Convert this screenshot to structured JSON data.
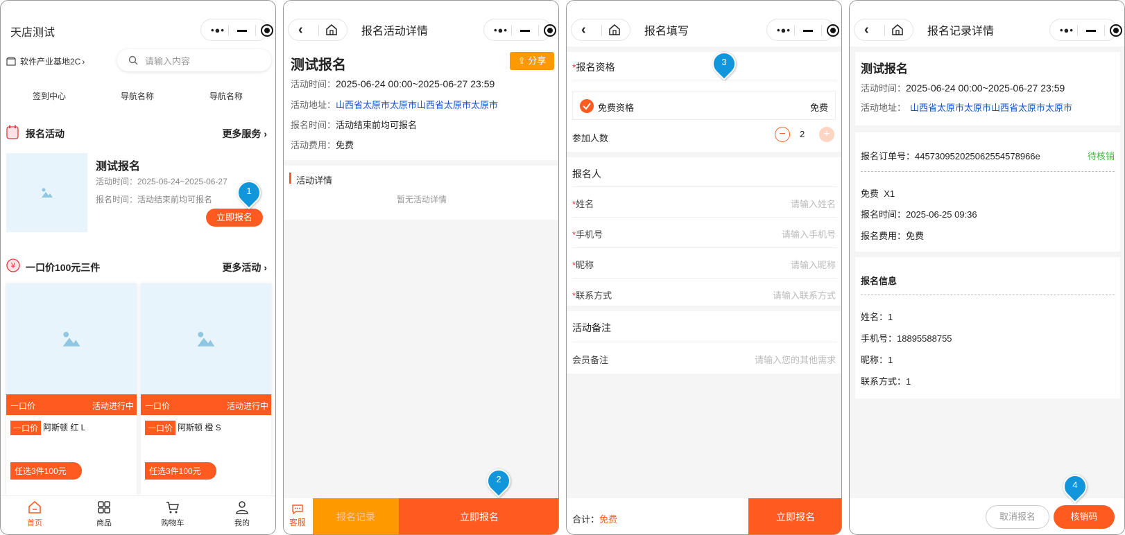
{
  "screen1": {
    "title": "天店测试",
    "location": "软件产业基地2C",
    "search_placeholder": "请输入内容",
    "nav_items": [
      "签到中心",
      "导航名称",
      "导航名称"
    ],
    "section1_title": "报名活动",
    "section1_more": "更多服务",
    "activity": {
      "name": "测试报名",
      "time": "活动时间：2025-06-24~2025-06-27",
      "signup": "报名时间：活动结束前均可报名",
      "button": "立即报名"
    },
    "section2_title": "一口价100元三件",
    "section2_more": "更多活动",
    "products": [
      {
        "ribbon_left": "一口价",
        "ribbon_right": "活动进行中",
        "tag": "一口价",
        "name": "阿斯顿 红 L",
        "promo": "任选3件100元"
      },
      {
        "ribbon_left": "一口价",
        "ribbon_right": "活动进行中",
        "tag": "一口价",
        "name": "阿斯顿 橙 S",
        "promo": "任选3件100元"
      }
    ],
    "tabs": [
      "首页",
      "商品",
      "购物车",
      "我的"
    ],
    "pin": "1"
  },
  "screen2": {
    "title": "报名活动详情",
    "name": "测试报名",
    "share": "分享",
    "time_label": "活动时间：",
    "time_value": "2025-06-24 00:00~2025-06-27 23:59",
    "address_label": "活动地址：",
    "address_value": "山西省太原市太原市山西省太原市太原市",
    "signup_label": "报名时间：",
    "signup_value": "活动结束前均可报名",
    "fee_label": "活动费用：",
    "fee_value": "免费",
    "detail_title": "活动详情",
    "detail_empty": "暂无活动详情",
    "service": "客服",
    "records_btn": "报名记录",
    "signup_btn": "立即报名",
    "pin": "2"
  },
  "screen3": {
    "title": "报名填写",
    "qual_label": "报名资格",
    "qual_option": "免费资格",
    "qual_price": "免费",
    "count_label": "参加人数",
    "count_value": "2",
    "person_title": "报名人",
    "fields": [
      {
        "label": "姓名",
        "placeholder": "请输入姓名"
      },
      {
        "label": "手机号",
        "placeholder": "请输入手机号"
      },
      {
        "label": "昵称",
        "placeholder": "请输入昵称"
      },
      {
        "label": "联系方式",
        "placeholder": "请输入联系方式"
      }
    ],
    "remark_title": "活动备注",
    "remark_label": "会员备注",
    "remark_placeholder": "请输入您的其他需求",
    "total_label": "合计：",
    "total_value": "免费",
    "submit": "立即报名",
    "pin": "3",
    "accent": "#ff5a1f"
  },
  "screen4": {
    "title": "报名记录详情",
    "name": "测试报名",
    "time_label": "活动时间：",
    "time_value": "2025-06-24 00:00~2025-06-27 23:59",
    "address_label": "活动地址：",
    "address_value": "山西省太原市太原市山西省太原市太原市",
    "order_label": "报名订单号：",
    "order_value": "445730952025062554578966e",
    "status": "待核销",
    "item": "免费  X1",
    "signup_time": "报名时间：2025-06-25 09:36",
    "fee": "报名费用：免费",
    "info_title": "报名信息",
    "info": [
      "姓名：1",
      "手机号：18895588755",
      "昵称：1",
      "联系方式：1"
    ],
    "cancel": "取消报名",
    "verify": "核销码",
    "pin": "4",
    "status_color": "#3cb83c"
  }
}
